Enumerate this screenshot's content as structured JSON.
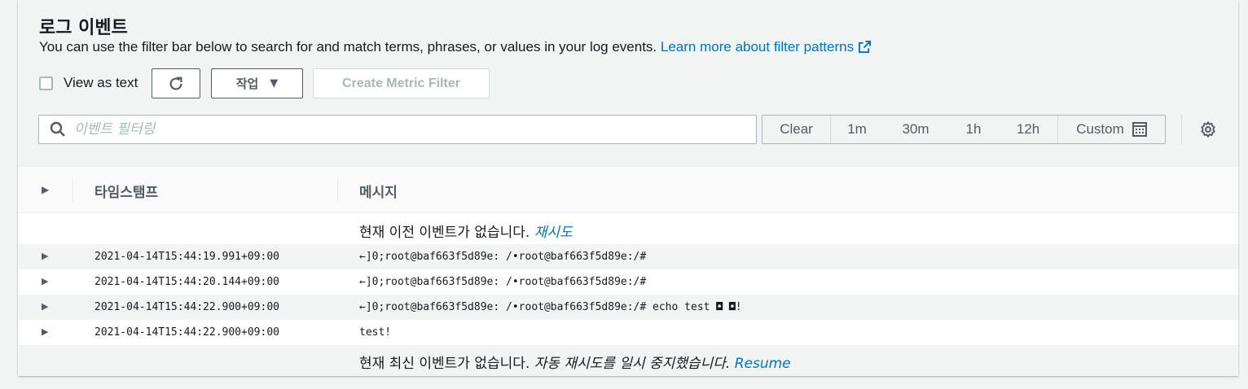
{
  "header": {
    "title": "로그 이벤트",
    "description": "You can use the filter bar below to search for and match terms, phrases, or values in your log events.",
    "learn_more": "Learn more about filter patterns"
  },
  "controls": {
    "view_as_text": "View as text",
    "action_label": "작업",
    "create_metric_filter": "Create Metric Filter"
  },
  "filter": {
    "placeholder": "이벤트 필터링",
    "value": ""
  },
  "time_range": {
    "clear": "Clear",
    "options": [
      "1m",
      "30m",
      "1h",
      "12h"
    ],
    "custom": "Custom"
  },
  "table": {
    "columns": [
      "타임스탬프",
      "메시지"
    ],
    "top_notice": "현재 이전 이벤트가 없습니다.",
    "top_retry": "재시도",
    "bottom_notice": "현재 최신 이벤트가 없습니다.",
    "bottom_paused": "자동 재시도를 일시 중지했습니다.",
    "bottom_resume": "Resume",
    "rows": [
      {
        "timestamp": "2021-04-14T15:44:19.991+09:00",
        "message": "←]0;root@baf663f5d89e: /•root@baf663f5d89e:/#"
      },
      {
        "timestamp": "2021-04-14T15:44:20.144+09:00",
        "message": "←]0;root@baf663f5d89e: /•root@baf663f5d89e:/#"
      },
      {
        "timestamp": "2021-04-14T15:44:22.900+09:00",
        "message": "←]0;root@baf663f5d89e: /•root@baf663f5d89e:/# echo test ◘ ◘!"
      },
      {
        "timestamp": "2021-04-14T15:44:22.900+09:00",
        "message": "test!"
      }
    ]
  },
  "colors": {
    "link": "#0073bb",
    "header_bg": "#f2f3f3",
    "border": "#aab7b8"
  }
}
